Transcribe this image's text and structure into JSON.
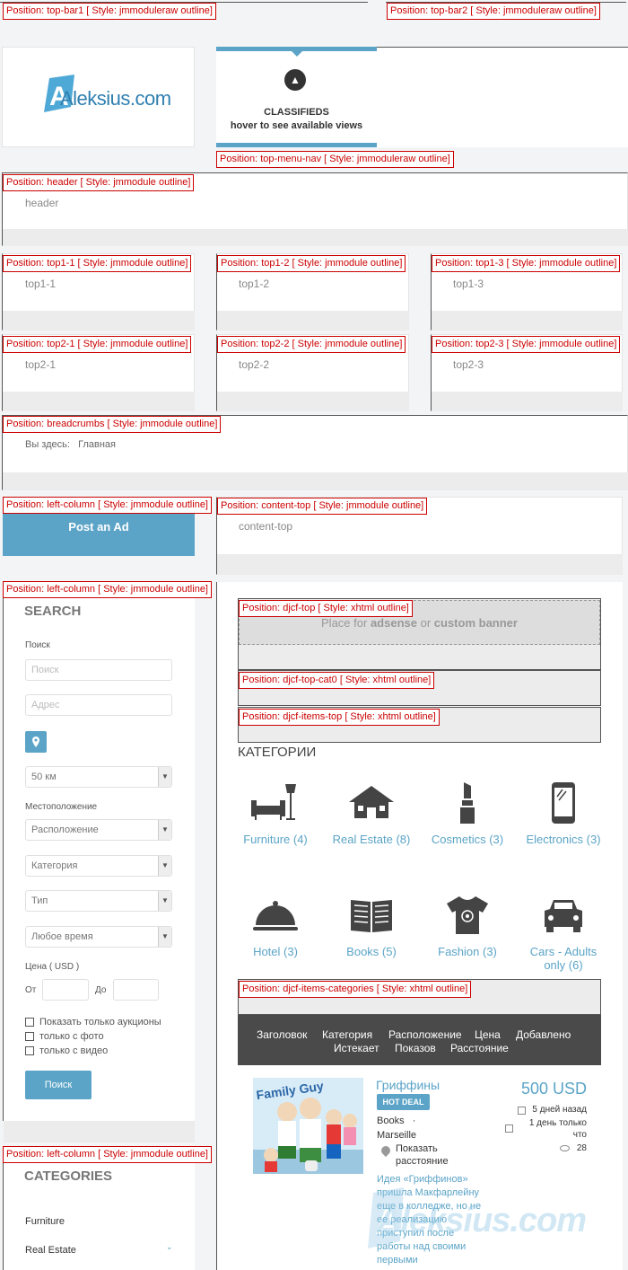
{
  "positions": {
    "top_bar1": "Position: top-bar1 [ Style: jmmoduleraw outline]",
    "top_bar2": "Position: top-bar2 [ Style: jmmoduleraw outline]",
    "top_menu_nav": "Position: top-menu-nav [ Style: jmmoduleraw outline]",
    "header": "Position: header [ Style: jmmodule outline]",
    "top1_1": "Position: top1-1 [ Style: jmmodule outline]",
    "top1_2": "Position: top1-2 [ Style: jmmodule outline]",
    "top1_3": "Position: top1-3 [ Style: jmmodule outline]",
    "top2_1": "Position: top2-1 [ Style: jmmodule outline]",
    "top2_2": "Position: top2-2 [ Style: jmmodule outline]",
    "top2_3": "Position: top2-3 [ Style: jmmodule outline]",
    "breadcrumbs": "Position: breadcrumbs [ Style: jmmodule outline]",
    "left_column_1": "Position: left-column [ Style: jmmodule outline]",
    "content_top": "Position: content-top [ Style: jmmodule outline]",
    "left_column_2": "Position: left-column [ Style: jmmodule outline]",
    "djcf_top": "Position: djcf-top [ Style: xhtml outline]",
    "djcf_top_cat0": "Position: djcf-top-cat0 [ Style: xhtml outline]",
    "djcf_items_top": "Position: djcf-items-top [ Style: xhtml outline]",
    "djcf_items_categories": "Position: djcf-items-categories [ Style: xhtml outline]",
    "left_column_3": "Position: left-column [ Style: jmmodule outline]"
  },
  "logo": {
    "text": "Aleksius.com"
  },
  "menu": {
    "title": "CLASSIFIEDS",
    "subtitle": "hover to see available views"
  },
  "modules": {
    "header": "header",
    "top1_1": "top1-1",
    "top1_2": "top1-2",
    "top1_3": "top1-3",
    "top2_1": "top2-1",
    "top2_2": "top2-2",
    "top2_3": "top2-3",
    "content_top": "content-top"
  },
  "breadcrumbs": {
    "label": "Вы здесь:",
    "home": "Главная"
  },
  "post_ad": "Post an Ad",
  "search": {
    "title": "SEARCH",
    "search_label": "Поиск",
    "search_placeholder": "Поиск",
    "address_placeholder": "Адрес",
    "radius": "50 км",
    "location_label": "Местоположение",
    "location": "Расположение",
    "category": "Категория",
    "type": "Тип",
    "time": "Любое время",
    "price_label": "Цена ( USD )",
    "from": "От",
    "to": "До",
    "only_auctions": "Показать только аукционы",
    "only_photo": "только с фото",
    "only_video": "только с видео",
    "button": "Поиск"
  },
  "banner": {
    "prefix": "Place for ",
    "adsense": "adsense",
    "or": " or ",
    "custom": "custom banner"
  },
  "categories_heading": "КАТЕГОРИИ",
  "categories": [
    {
      "name": "Furniture (4)",
      "icon": "furniture-icon"
    },
    {
      "name": "Real Estate (8)",
      "icon": "house-icon"
    },
    {
      "name": "Cosmetics (3)",
      "icon": "lipstick-icon"
    },
    {
      "name": "Electronics (3)",
      "icon": "phone-icon"
    },
    {
      "name": "Hotel (3)",
      "icon": "cloche-icon"
    },
    {
      "name": "Books (5)",
      "icon": "book-icon"
    },
    {
      "name": "Fashion (3)",
      "icon": "tshirt-icon"
    },
    {
      "name": "Cars - Adults only (6)",
      "icon": "car-icon"
    }
  ],
  "table_headers": [
    "Заголовок",
    "Категория",
    "Расположение",
    "Цена",
    "Добавлено",
    "Истекает",
    "Показов",
    "Расстояние"
  ],
  "ad": {
    "title": "Гриффины",
    "badge": "HOT DEAL",
    "category": "Books",
    "location": "Marseille",
    "show_distance": "Показать расстояние",
    "price": "500 USD",
    "added": "5 дней назад",
    "expires": "1 день только что",
    "views": "28",
    "description": "Идея «Гриффинов» пришла Макфарлейну еще в колледже, но не ее реализацию приступил после работы над своими первыми",
    "thumb_caption": "Family Guy"
  },
  "categories_module": {
    "title": "CATEGORIES",
    "items": [
      "Furniture",
      "Real Estate"
    ]
  },
  "watermark": "Aleksius.com",
  "colors": {
    "accent": "#5ba4c7",
    "outline": "#cc0000",
    "dark_header": "#4a4a4a"
  }
}
